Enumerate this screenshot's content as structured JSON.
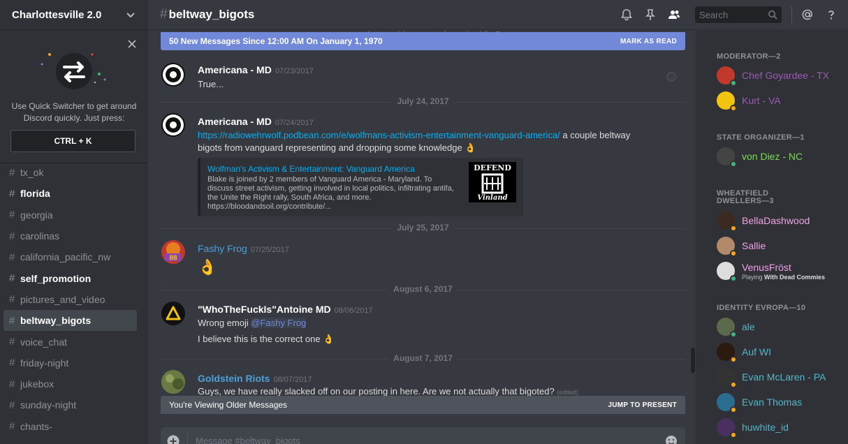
{
  "server": {
    "name": "Charlottesville 2.0"
  },
  "quick_switcher": {
    "text": "Use Quick Switcher to get around Discord quickly. Just press:",
    "shortcut": "CTRL + K"
  },
  "channels": [
    {
      "name": "tx_ok",
      "state": "normal"
    },
    {
      "name": "florida",
      "state": "unread"
    },
    {
      "name": "georgia",
      "state": "normal"
    },
    {
      "name": "carolinas",
      "state": "normal"
    },
    {
      "name": "california_pacific_nw",
      "state": "normal"
    },
    {
      "name": "self_promotion",
      "state": "unread"
    },
    {
      "name": "pictures_and_video",
      "state": "normal"
    },
    {
      "name": "beltway_bigots",
      "state": "active"
    },
    {
      "name": "voice_chat",
      "state": "normal"
    },
    {
      "name": "friday-night",
      "state": "normal"
    },
    {
      "name": "jukebox",
      "state": "normal"
    },
    {
      "name": "sunday-night",
      "state": "normal"
    },
    {
      "name": "chants-",
      "state": "normal"
    }
  ],
  "header": {
    "hash": "#",
    "channel": "beltway_bigots",
    "search_placeholder": "Search",
    "icons": [
      "bell-icon",
      "pin-icon",
      "members-icon",
      "search-icon",
      "at-icon",
      "help-icon"
    ]
  },
  "chat": {
    "cutoff_text": "... but could you not shoot the kike?",
    "new_messages_bar": "50 New Messages Since 12:00 AM On January 1, 1970",
    "mark_as_read": "MARK AS READ",
    "dividers": [
      "July 24, 2017",
      "July 25, 2017",
      "August 6, 2017",
      "August 7, 2017"
    ],
    "messages": [
      {
        "author": "Americana - MD",
        "timestamp": "07/23/2017",
        "color": "#ffffff",
        "lines": [
          "True..."
        ]
      },
      {
        "author": "Americana - MD",
        "timestamp": "07/24/2017",
        "color": "#ffffff",
        "link": "https://radiowehrwolf.podbean.com/e/wolfmans-activism-entertainment-vanguard-america/",
        "after_link": " a couple beltway",
        "line2": "bigots from vanguard representing and dropping some knowledge 👌",
        "embed": {
          "title": "Wolfman's Activism & Entertainment: Vanguard America",
          "description": "Blake is joined by 2 members of Vanguard America - Maryland. To discuss street activism, getting involved in local politics, infiltrating antifa, the Unite the Right rally, South Africa, and more. https://bloodandsoil.org/contribute/...",
          "thumb_top": "DEFEND",
          "thumb_bottom": "Vinland"
        }
      },
      {
        "author": "Fashy Frog",
        "timestamp": "07/25/2017",
        "color": "#4ea0d8",
        "lines": [
          "👌"
        ],
        "avatar_text": "88"
      },
      {
        "author": "\"WhoTheFuckIs\"Antoine MD",
        "timestamp": "08/06/2017",
        "color": "#ffffff",
        "line1_prefix": "Wrong emoji ",
        "mention": "@Fashy Frog",
        "line2": "I believe this is the correct one 👌"
      },
      {
        "author": "Goldstein Riots",
        "timestamp": "08/07/2017",
        "color": "#4ea0d8",
        "lines": [
          "Guys, we have really slacked off on our posting in here.  Are we not actually that bigoted?"
        ],
        "edited": "(edited)"
      }
    ],
    "older_bar": "You're Viewing Older Messages",
    "jump_to_present": "JUMP TO PRESENT",
    "composer_placeholder": "Message #beltway_bigots"
  },
  "members": {
    "groups": [
      {
        "role": "MODERATOR—2",
        "members": [
          {
            "name": "Chef Goyardee - TX",
            "color": "#9b59b6",
            "status": "#43b581"
          },
          {
            "name": "Kurt - VA",
            "color": "#9b59b6",
            "status": "#faa61a"
          }
        ]
      },
      {
        "role": "STATE ORGANIZER—1",
        "members": [
          {
            "name": "von Diez - NC",
            "color": "#7cd957",
            "status": "#43b581"
          }
        ]
      },
      {
        "role": "WHEATFIELD DWELLERS—3",
        "members": [
          {
            "name": "BellaDashwood",
            "color": "#f1a2e6",
            "status": "#faa61a"
          },
          {
            "name": "Sallie",
            "color": "#f1a2e6",
            "status": "#faa61a"
          },
          {
            "name": "VenusFröst",
            "color": "#f1a2e6",
            "status": "#43b581",
            "activity_prefix": "Playing ",
            "activity": "With Dead Commies"
          }
        ]
      },
      {
        "role": "IDENTITY EVROPA—10",
        "members": [
          {
            "name": "ale",
            "color": "#4fb8c9",
            "status": "#43b581"
          },
          {
            "name": "Auf WI",
            "color": "#4fb8c9",
            "status": "#faa61a"
          },
          {
            "name": "Evan McLaren - PA",
            "color": "#4fb8c9",
            "status": "#faa61a"
          },
          {
            "name": "Evan Thomas",
            "color": "#4fb8c9",
            "status": "#faa61a"
          },
          {
            "name": "huwhite_id",
            "color": "#4fb8c9",
            "status": "#faa61a"
          }
        ]
      }
    ]
  }
}
